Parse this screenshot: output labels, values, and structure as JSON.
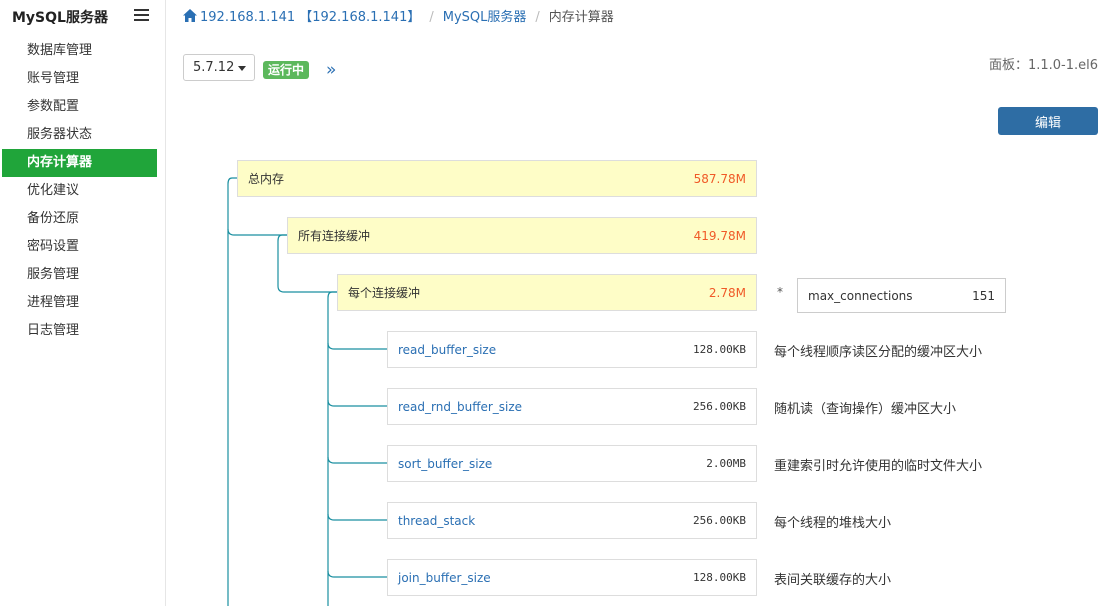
{
  "sidebar": {
    "brand": "MySQL服务器",
    "items": [
      {
        "label": "数据库管理"
      },
      {
        "label": "账号管理"
      },
      {
        "label": "参数配置"
      },
      {
        "label": "服务器状态"
      },
      {
        "label": "内存计算器",
        "active": true
      },
      {
        "label": "优化建议"
      },
      {
        "label": "备份还原"
      },
      {
        "label": "密码设置"
      },
      {
        "label": "服务管理"
      },
      {
        "label": "进程管理"
      },
      {
        "label": "日志管理"
      }
    ]
  },
  "breadcrumb": {
    "host": "192.168.1.141 【192.168.1.141】",
    "service": "MySQL服务器",
    "current": "内存计算器"
  },
  "toolbar": {
    "version": "5.7.12",
    "status": "运行中",
    "panel_version": "面板：1.1.0-1.el6",
    "edit_label": "编辑"
  },
  "colors": {
    "accent_green": "#20a53a",
    "status_green": "#5cb85c",
    "link_blue": "#2a6fb3",
    "button_blue": "#2e6da4",
    "value_orange": "#f05a28",
    "node_yellow": "#fefdc7",
    "tree_line": "#1a8fa0"
  },
  "memory_tree": {
    "total": {
      "label": "总内存",
      "value": "587.78M"
    },
    "all_connections": {
      "label": "所有连接缓冲",
      "value": "419.78M"
    },
    "per_connection": {
      "label": "每个连接缓冲",
      "value": "2.78M"
    },
    "multiplier": "*",
    "max_connections": {
      "label": "max_connections",
      "value": "151"
    },
    "params": [
      {
        "name": "read_buffer_size",
        "value": "128.00KB",
        "desc": "每个线程顺序读区分配的缓冲区大小"
      },
      {
        "name": "read_rnd_buffer_size",
        "value": "256.00KB",
        "desc": "随机读（查询操作）缓冲区大小"
      },
      {
        "name": "sort_buffer_size",
        "value": "2.00MB",
        "desc": "重建索引时允许使用的临时文件大小"
      },
      {
        "name": "thread_stack",
        "value": "256.00KB",
        "desc": "每个线程的堆栈大小"
      },
      {
        "name": "join_buffer_size",
        "value": "128.00KB",
        "desc": "表间关联缓存的大小"
      }
    ]
  }
}
